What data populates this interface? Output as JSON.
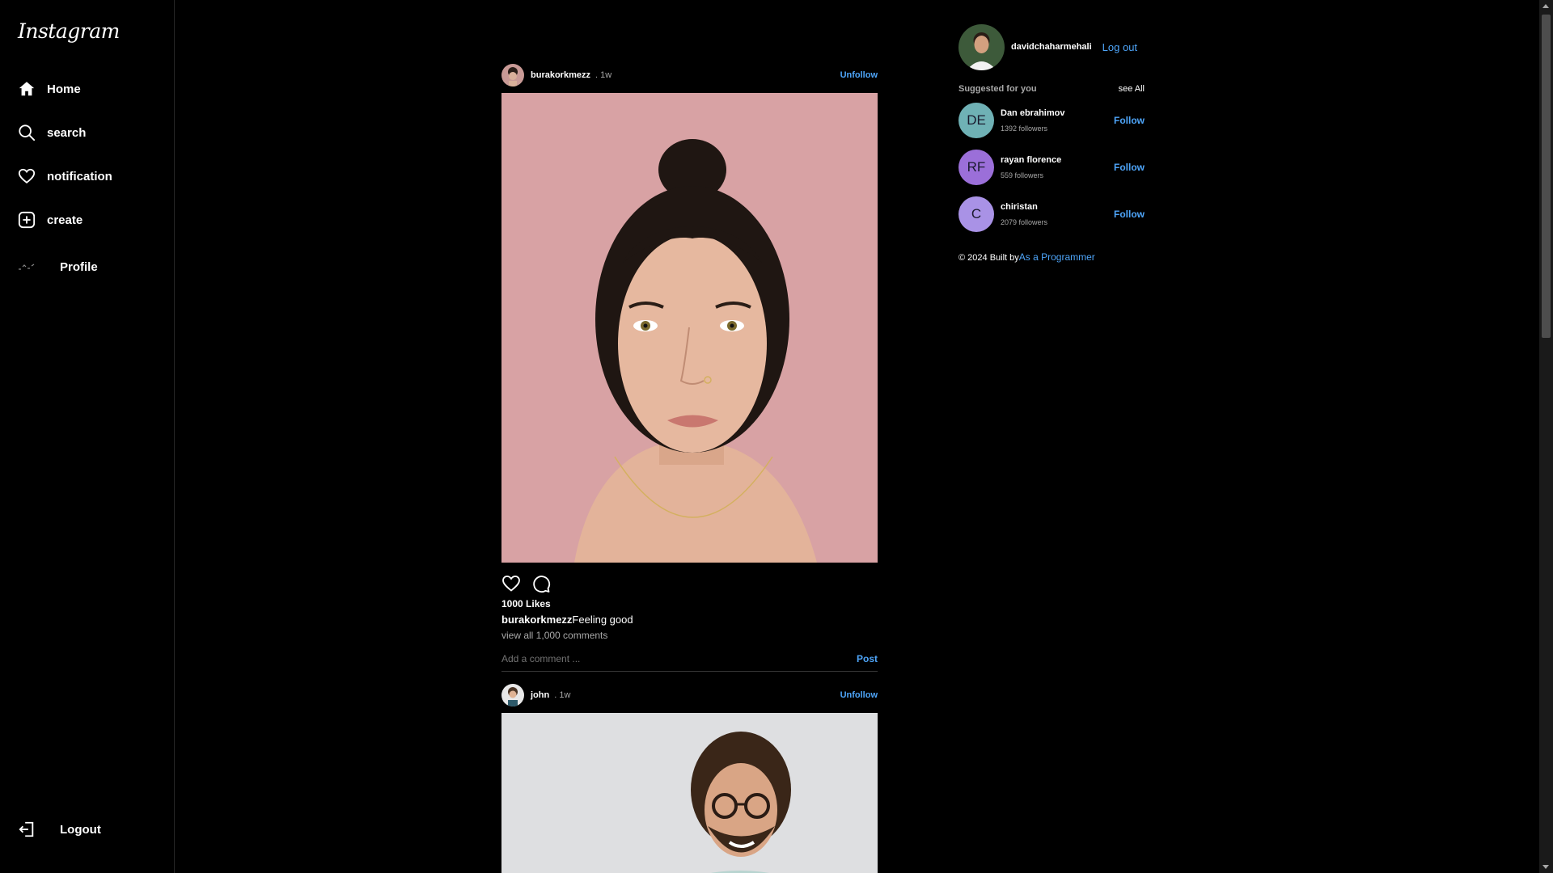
{
  "sidebar": {
    "logo": "Instagram",
    "items": [
      {
        "label": "Home",
        "icon": "home-icon"
      },
      {
        "label": "search",
        "icon": "search-icon"
      },
      {
        "label": "notification",
        "icon": "heart-icon"
      },
      {
        "label": "create",
        "icon": "plus-square-icon"
      },
      {
        "label": "Profile",
        "icon": "profile-avatar-icon"
      }
    ],
    "logout_label": "Logout"
  },
  "feed": {
    "posts": [
      {
        "user": "burakorkmezz",
        "time": ". 1w",
        "follow_action": "Unfollow",
        "likes": "1000 Likes",
        "caption_user": "burakorkmezz",
        "caption_text": "Feeling good",
        "comments_link": "view all 1,000 comments",
        "comment_placeholder": "Add a comment ...",
        "post_button": "Post"
      },
      {
        "user": "john",
        "time": ". 1w",
        "follow_action": "Unfollow"
      }
    ]
  },
  "right": {
    "username": "davidchaharmehali",
    "logout_label": "Log out",
    "suggested_title": "Suggested for you",
    "see_all": "see All",
    "suggestions": [
      {
        "initials": "DE",
        "name": "Dan ebrahimov",
        "followers": "1392 followers",
        "follow": "Follow",
        "color": "#6fb1b5"
      },
      {
        "initials": "RF",
        "name": "rayan florence",
        "followers": "559 followers",
        "follow": "Follow",
        "color": "#9b6fd9"
      },
      {
        "initials": "C",
        "name": "chiristan",
        "followers": "2079 followers",
        "follow": "Follow",
        "color": "#a992e6"
      }
    ],
    "footer_prefix": "© 2024 Built by",
    "footer_link": "As a Programmer"
  },
  "colors": {
    "background": "#000000",
    "accent": "#4ea5f9",
    "muted": "#a8a8a8"
  }
}
